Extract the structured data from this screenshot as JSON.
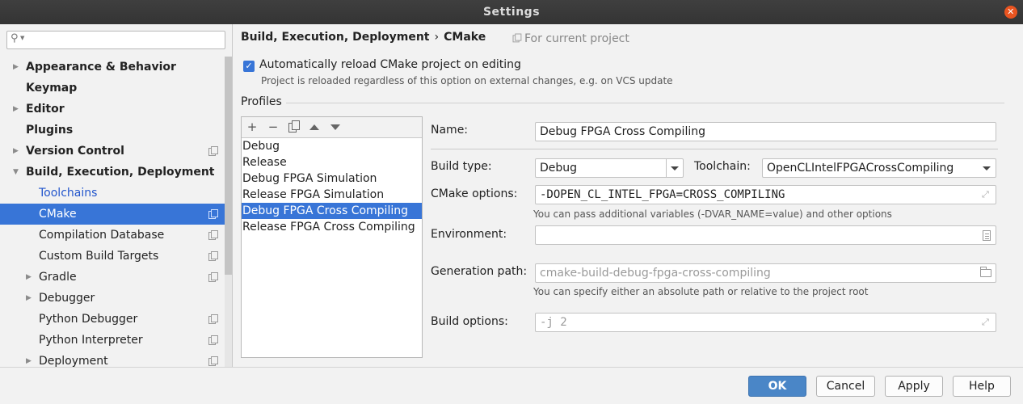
{
  "window": {
    "title": "Settings"
  },
  "sidebar": {
    "search_placeholder": "",
    "items": [
      {
        "label": "Appearance & Behavior",
        "level": 0,
        "bold": true,
        "expandable": true,
        "expanded": false,
        "project_icon": false
      },
      {
        "label": "Keymap",
        "level": 0,
        "bold": true,
        "expandable": false,
        "project_icon": false
      },
      {
        "label": "Editor",
        "level": 0,
        "bold": true,
        "expandable": true,
        "expanded": false,
        "project_icon": false
      },
      {
        "label": "Plugins",
        "level": 0,
        "bold": true,
        "expandable": false,
        "project_icon": false
      },
      {
        "label": "Version Control",
        "level": 0,
        "bold": true,
        "expandable": true,
        "expanded": false,
        "project_icon": true
      },
      {
        "label": "Build, Execution, Deployment",
        "level": 0,
        "bold": true,
        "expandable": true,
        "expanded": true,
        "project_icon": false
      },
      {
        "label": "Toolchains",
        "level": 1,
        "link": true,
        "expandable": false,
        "project_icon": false
      },
      {
        "label": "CMake",
        "level": 1,
        "selected": true,
        "expandable": false,
        "project_icon": true
      },
      {
        "label": "Compilation Database",
        "level": 1,
        "expandable": false,
        "project_icon": true
      },
      {
        "label": "Custom Build Targets",
        "level": 1,
        "expandable": false,
        "project_icon": true
      },
      {
        "label": "Gradle",
        "level": 1,
        "expandable": true,
        "expanded": false,
        "project_icon": true
      },
      {
        "label": "Debugger",
        "level": 1,
        "expandable": true,
        "expanded": false,
        "project_icon": false
      },
      {
        "label": "Python Debugger",
        "level": 1,
        "expandable": false,
        "project_icon": true
      },
      {
        "label": "Python Interpreter",
        "level": 1,
        "expandable": false,
        "project_icon": true
      },
      {
        "label": "Deployment",
        "level": 1,
        "expandable": true,
        "expanded": false,
        "project_icon": true
      }
    ]
  },
  "header": {
    "breadcrumb_parent": "Build, Execution, Deployment",
    "breadcrumb_sep": "›",
    "breadcrumb_current": "CMake",
    "scope_note": "For current project"
  },
  "auto_reload": {
    "checked": true,
    "label": "Automatically reload CMake project on editing",
    "hint": "Project is reloaded regardless of this option on external changes, e.g. on VCS update"
  },
  "profiles": {
    "section_label": "Profiles",
    "items": [
      "Debug",
      "Release",
      "Debug FPGA Simulation",
      "Release FPGA Simulation",
      "Debug FPGA Cross Compiling",
      "Release FPGA Cross Compiling"
    ],
    "selected_index": 4
  },
  "form": {
    "name_label": "Name:",
    "name_value": "Debug FPGA Cross Compiling",
    "build_type_label": "Build type:",
    "build_type_value": "Debug",
    "toolchain_label": "Toolchain:",
    "toolchain_value": "OpenCLIntelFPGACrossCompiling",
    "cmake_options_label": "CMake options:",
    "cmake_options_value": "-DOPEN_CL_INTEL_FPGA=CROSS_COMPILING",
    "cmake_options_hint": "You can pass additional variables (-DVAR_NAME=value) and other options",
    "environment_label": "Environment:",
    "environment_value": "",
    "generation_path_label": "Generation path:",
    "generation_path_placeholder": "cmake-build-debug-fpga-cross-compiling",
    "generation_path_hint": "You can specify either an absolute path or relative to the project root",
    "build_options_label": "Build options:",
    "build_options_placeholder": "-j 2"
  },
  "footer": {
    "ok": "OK",
    "cancel": "Cancel",
    "apply": "Apply",
    "help": "Help"
  },
  "colors": {
    "selection": "#3875d7",
    "link": "#2255cc",
    "primary_button": "#4a86c7",
    "close_button": "#e95420"
  },
  "icons": {
    "close": "close-icon",
    "search": "search-icon",
    "project_scope": "project-scope-icon",
    "add": "plus-icon",
    "remove": "minus-icon",
    "copy": "copy-icon",
    "move_up": "arrow-up-icon",
    "move_down": "arrow-down-icon"
  }
}
